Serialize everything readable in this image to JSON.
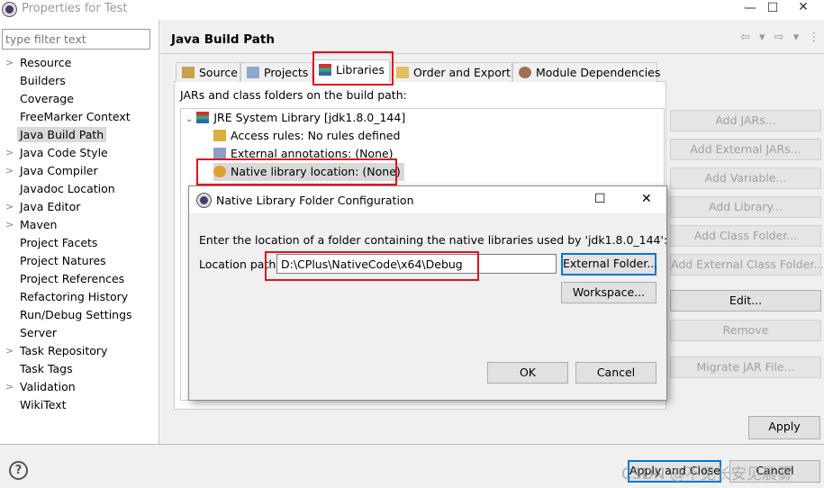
{
  "window": {
    "title": "Properties for Test",
    "minimize": "—",
    "maximize": "☐",
    "close": "✕"
  },
  "filter": {
    "placeholder": "type filter text"
  },
  "nav": [
    {
      "label": "Resource",
      "expandable": true
    },
    {
      "label": "Builders"
    },
    {
      "label": "Coverage"
    },
    {
      "label": "FreeMarker Context"
    },
    {
      "label": "Java Build Path",
      "selected": true
    },
    {
      "label": "Java Code Style",
      "expandable": true
    },
    {
      "label": "Java Compiler",
      "expandable": true
    },
    {
      "label": "Javadoc Location"
    },
    {
      "label": "Java Editor",
      "expandable": true
    },
    {
      "label": "Maven",
      "expandable": true
    },
    {
      "label": "Project Facets"
    },
    {
      "label": "Project Natures"
    },
    {
      "label": "Project References"
    },
    {
      "label": "Refactoring History"
    },
    {
      "label": "Run/Debug Settings"
    },
    {
      "label": "Server"
    },
    {
      "label": "Task Repository",
      "expandable": true
    },
    {
      "label": "Task Tags"
    },
    {
      "label": "Validation",
      "expandable": true
    },
    {
      "label": "WikiText"
    }
  ],
  "header": {
    "title": "Java Build Path",
    "nav_arrows": "⇦ ▾ ⇨ ▾ ⋮"
  },
  "tabs": [
    {
      "label": "Source"
    },
    {
      "label": "Projects"
    },
    {
      "label": "Libraries",
      "active": true
    },
    {
      "label": "Order and Export"
    },
    {
      "label": "Module Dependencies"
    }
  ],
  "libraries": {
    "caption": "JARs and class folders on the build path:",
    "tree": {
      "root": "JRE System Library [jdk1.8.0_144]",
      "children": [
        "Access rules: No rules defined",
        "External annotations: (None)",
        "Native library location: (None)"
      ]
    },
    "buttons": [
      {
        "label": "Add JARs...",
        "enabled": false
      },
      {
        "label": "Add External JARs...",
        "enabled": false
      },
      {
        "label": "Add Variable...",
        "enabled": false
      },
      {
        "label": "Add Library...",
        "enabled": false
      },
      {
        "label": "Add Class Folder...",
        "enabled": false
      },
      {
        "label": "Add External Class Folder...",
        "enabled": false
      },
      {
        "label": "Edit...",
        "enabled": true
      },
      {
        "label": "Remove",
        "enabled": false
      },
      {
        "label": "Migrate JAR File...",
        "enabled": false
      }
    ]
  },
  "apply": "Apply",
  "footer": {
    "apply_close": "Apply and Close",
    "cancel": "Cancel",
    "help": "?",
    "watermark": "CSDN @不见长安见晨雾"
  },
  "dialog": {
    "title": "Native Library Folder Configuration",
    "message": "Enter the location of a folder containing the native libraries used by 'jdk1.8.0_144':",
    "location_label": "Location path:",
    "location_value": "D:\\CPlus\\NativeCode\\x64\\Debug",
    "external_folder": "External Folder...",
    "workspace": "Workspace...",
    "ok": "OK",
    "cancel": "Cancel",
    "maximize": "☐",
    "close": "✕"
  },
  "colors": {
    "highlight": "#e0141e",
    "focus": "#0078d7"
  }
}
